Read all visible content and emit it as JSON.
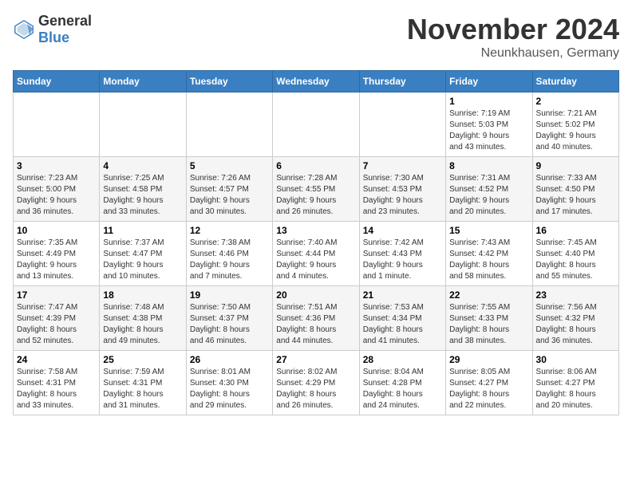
{
  "header": {
    "logo_general": "General",
    "logo_blue": "Blue",
    "month_year": "November 2024",
    "location": "Neunkhausen, Germany"
  },
  "weekdays": [
    "Sunday",
    "Monday",
    "Tuesday",
    "Wednesday",
    "Thursday",
    "Friday",
    "Saturday"
  ],
  "weeks": [
    [
      {
        "day": "",
        "info": ""
      },
      {
        "day": "",
        "info": ""
      },
      {
        "day": "",
        "info": ""
      },
      {
        "day": "",
        "info": ""
      },
      {
        "day": "",
        "info": ""
      },
      {
        "day": "1",
        "info": "Sunrise: 7:19 AM\nSunset: 5:03 PM\nDaylight: 9 hours\nand 43 minutes."
      },
      {
        "day": "2",
        "info": "Sunrise: 7:21 AM\nSunset: 5:02 PM\nDaylight: 9 hours\nand 40 minutes."
      }
    ],
    [
      {
        "day": "3",
        "info": "Sunrise: 7:23 AM\nSunset: 5:00 PM\nDaylight: 9 hours\nand 36 minutes."
      },
      {
        "day": "4",
        "info": "Sunrise: 7:25 AM\nSunset: 4:58 PM\nDaylight: 9 hours\nand 33 minutes."
      },
      {
        "day": "5",
        "info": "Sunrise: 7:26 AM\nSunset: 4:57 PM\nDaylight: 9 hours\nand 30 minutes."
      },
      {
        "day": "6",
        "info": "Sunrise: 7:28 AM\nSunset: 4:55 PM\nDaylight: 9 hours\nand 26 minutes."
      },
      {
        "day": "7",
        "info": "Sunrise: 7:30 AM\nSunset: 4:53 PM\nDaylight: 9 hours\nand 23 minutes."
      },
      {
        "day": "8",
        "info": "Sunrise: 7:31 AM\nSunset: 4:52 PM\nDaylight: 9 hours\nand 20 minutes."
      },
      {
        "day": "9",
        "info": "Sunrise: 7:33 AM\nSunset: 4:50 PM\nDaylight: 9 hours\nand 17 minutes."
      }
    ],
    [
      {
        "day": "10",
        "info": "Sunrise: 7:35 AM\nSunset: 4:49 PM\nDaylight: 9 hours\nand 13 minutes."
      },
      {
        "day": "11",
        "info": "Sunrise: 7:37 AM\nSunset: 4:47 PM\nDaylight: 9 hours\nand 10 minutes."
      },
      {
        "day": "12",
        "info": "Sunrise: 7:38 AM\nSunset: 4:46 PM\nDaylight: 9 hours\nand 7 minutes."
      },
      {
        "day": "13",
        "info": "Sunrise: 7:40 AM\nSunset: 4:44 PM\nDaylight: 9 hours\nand 4 minutes."
      },
      {
        "day": "14",
        "info": "Sunrise: 7:42 AM\nSunset: 4:43 PM\nDaylight: 9 hours\nand 1 minute."
      },
      {
        "day": "15",
        "info": "Sunrise: 7:43 AM\nSunset: 4:42 PM\nDaylight: 8 hours\nand 58 minutes."
      },
      {
        "day": "16",
        "info": "Sunrise: 7:45 AM\nSunset: 4:40 PM\nDaylight: 8 hours\nand 55 minutes."
      }
    ],
    [
      {
        "day": "17",
        "info": "Sunrise: 7:47 AM\nSunset: 4:39 PM\nDaylight: 8 hours\nand 52 minutes."
      },
      {
        "day": "18",
        "info": "Sunrise: 7:48 AM\nSunset: 4:38 PM\nDaylight: 8 hours\nand 49 minutes."
      },
      {
        "day": "19",
        "info": "Sunrise: 7:50 AM\nSunset: 4:37 PM\nDaylight: 8 hours\nand 46 minutes."
      },
      {
        "day": "20",
        "info": "Sunrise: 7:51 AM\nSunset: 4:36 PM\nDaylight: 8 hours\nand 44 minutes."
      },
      {
        "day": "21",
        "info": "Sunrise: 7:53 AM\nSunset: 4:34 PM\nDaylight: 8 hours\nand 41 minutes."
      },
      {
        "day": "22",
        "info": "Sunrise: 7:55 AM\nSunset: 4:33 PM\nDaylight: 8 hours\nand 38 minutes."
      },
      {
        "day": "23",
        "info": "Sunrise: 7:56 AM\nSunset: 4:32 PM\nDaylight: 8 hours\nand 36 minutes."
      }
    ],
    [
      {
        "day": "24",
        "info": "Sunrise: 7:58 AM\nSunset: 4:31 PM\nDaylight: 8 hours\nand 33 minutes."
      },
      {
        "day": "25",
        "info": "Sunrise: 7:59 AM\nSunset: 4:31 PM\nDaylight: 8 hours\nand 31 minutes."
      },
      {
        "day": "26",
        "info": "Sunrise: 8:01 AM\nSunset: 4:30 PM\nDaylight: 8 hours\nand 29 minutes."
      },
      {
        "day": "27",
        "info": "Sunrise: 8:02 AM\nSunset: 4:29 PM\nDaylight: 8 hours\nand 26 minutes."
      },
      {
        "day": "28",
        "info": "Sunrise: 8:04 AM\nSunset: 4:28 PM\nDaylight: 8 hours\nand 24 minutes."
      },
      {
        "day": "29",
        "info": "Sunrise: 8:05 AM\nSunset: 4:27 PM\nDaylight: 8 hours\nand 22 minutes."
      },
      {
        "day": "30",
        "info": "Sunrise: 8:06 AM\nSunset: 4:27 PM\nDaylight: 8 hours\nand 20 minutes."
      }
    ]
  ]
}
